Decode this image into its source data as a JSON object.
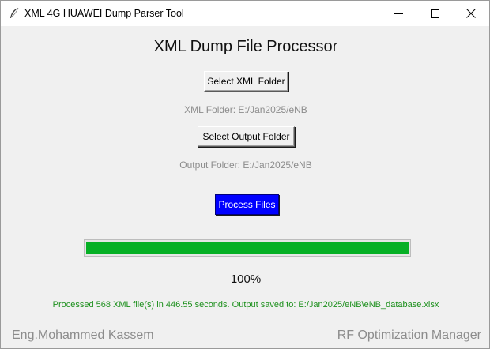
{
  "window": {
    "title": "XML 4G HUAWEI Dump Parser Tool",
    "icon": "feather-icon"
  },
  "main": {
    "title": "XML Dump File Processor",
    "select_xml_label": "Select XML Folder",
    "xml_folder_text": "XML Folder: E:/Jan2025/eNB",
    "select_output_label": "Select Output Folder",
    "output_folder_text": "Output Folder: E:/Jan2025/eNB",
    "process_label": "Process Files"
  },
  "progress": {
    "value": 1.0,
    "percent_text": "100%"
  },
  "status": {
    "message": "Processed 568 XML file(s) in 446.55 seconds. Output saved to: E:/Jan2025/eNB\\eNB_database.xlsx"
  },
  "footer": {
    "left": "Eng.Mohammed Kassem",
    "right": "RF Optimization Manager"
  },
  "colors": {
    "process_button": "#0000ff",
    "progress_fill": "#06b025",
    "status_text": "#1b8f1b",
    "muted_text": "#8c8c8c"
  }
}
